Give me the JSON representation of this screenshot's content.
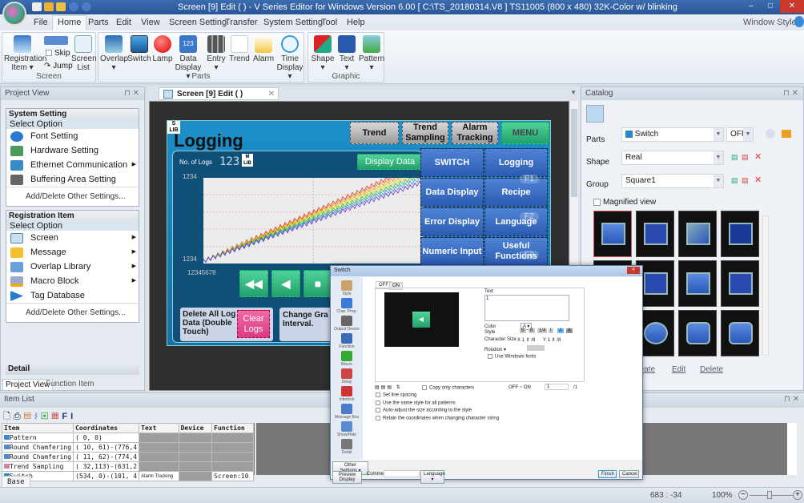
{
  "titlebar": {
    "title": "Screen [9] Edit (                    ) - V Series Editor for Windows Version 6.00 [ C:\\TS_20180314.V8 ] TS11005 (800 x 480) 32K-Color w/  blinking"
  },
  "menu": {
    "items": [
      "File",
      "Home",
      "Parts",
      "Edit",
      "View",
      "Screen Setting",
      "Transfer",
      "System Setting",
      "Tool",
      "Help"
    ],
    "active": "Home",
    "window_style": "Window Style"
  },
  "ribbon": {
    "screen_group": {
      "label": "Screen",
      "registration": "Registration Item",
      "skip": "Skip",
      "jump": "Jump",
      "screen_list": "Screen List"
    },
    "parts_group": {
      "label": "Parts",
      "items": [
        "Overlap",
        "Switch",
        "Lamp",
        "Data Display",
        "Entry",
        "Trend",
        "Alarm",
        "Time Display"
      ]
    },
    "graphic_group": {
      "label": "Graphic",
      "items": [
        "Shape",
        "Text",
        "Pattern"
      ]
    }
  },
  "project_view": {
    "title": "Project View",
    "system_setting": {
      "header": "System Setting",
      "select": "Select Option",
      "items": [
        "Font Setting",
        "Hardware Setting",
        "Ethernet Communication",
        "Buffering Area Setting"
      ],
      "add": "Add/Delete Other Settings..."
    },
    "registration_item": {
      "header": "Registration Item",
      "select": "Select Option",
      "items": [
        "Screen",
        "Message",
        "Overlap Library",
        "Macro Block",
        "Tag Database"
      ],
      "add": "Add/Delete Other Settings..."
    },
    "detail": "Detail",
    "tabs": [
      "Project View",
      "Function Item"
    ]
  },
  "editor": {
    "tab": "Screen [9] Edit (              )"
  },
  "hmi": {
    "title": "Logging",
    "top_buttons": [
      "Trend",
      "Trend Sampling",
      "Alarm Tracking",
      "MENU"
    ],
    "no_of_logs": "No. of Logs",
    "log_count": "123",
    "display_data": "Display Data",
    "y_top": "1234",
    "y_bottom": "1234",
    "x_label": "12345678",
    "menu_buttons": [
      "SWITCH",
      "Logging",
      "Data Display",
      "Recipe",
      "Error Display",
      "Language",
      "Numeric Input",
      "Useful Functions"
    ],
    "f_keys": [
      "F1",
      "F2",
      "F3"
    ],
    "delete_text": "Delete All Log Data (Double Touch)",
    "clear_logs": "Clear Logs",
    "change_text": "Change Gra Interval."
  },
  "catalog": {
    "title": "Catalog",
    "parts_label": "Parts",
    "parts_value": "Switch",
    "state_value": "OFF",
    "shape_label": "Shape",
    "shape_value": "Real",
    "group_label": "Group",
    "group_value": "Square1",
    "magnified": "Magnified view",
    "links": [
      "Create",
      "Edit",
      "Delete"
    ]
  },
  "item_list": {
    "title": "Item List",
    "columns": [
      "Item",
      "Coordinates",
      "Text",
      "Device",
      "Function"
    ],
    "rows": [
      {
        "item": "Pattern",
        "coords": "(  0,  0)",
        "text": "",
        "device": "",
        "function": ""
      },
      {
        "item": "Round Chamfering",
        "coords": "( 10, 61)-(776,4",
        "text": "",
        "device": "",
        "function": ""
      },
      {
        "item": "Round Chamfering",
        "coords": "( 11, 62)-(774,4",
        "text": "",
        "device": "",
        "function": ""
      },
      {
        "item": "Trend Sampling",
        "coords": "( 32,113)-(631,2",
        "text": "",
        "device": "",
        "function": ""
      },
      {
        "item": "Switch",
        "coords": "(534,  0)-(101, 4",
        "text": "Alarm Tracking",
        "device": "",
        "function": "Screen:10"
      }
    ],
    "tab": "Base"
  },
  "status": {
    "coords": "683 : -34",
    "zoom": "100%"
  },
  "dialog": {
    "title": "Switch",
    "side": [
      "Style",
      "Char. Prop.",
      "Output Device",
      "Function",
      "Macro",
      "Delay",
      "Interlock",
      "Message Box",
      "Show/Hide",
      "Detail"
    ],
    "tabs": [
      "OFF",
      "ON"
    ],
    "text_label": "Text",
    "text_value": "1",
    "color": "Color",
    "style": "Style",
    "char_size": "Character Size",
    "rotation": "Rotation",
    "size_x": "1",
    "size_y": "1",
    "size_div": "/8",
    "use_windows_fonts": "Use Windows fonts",
    "copy_only": "Copy only characters",
    "off_on": "OFF ~ ON",
    "off_on_value": "1",
    "off_on_max": "/1",
    "checks": [
      "Set line spacing",
      "Use the same style for all patterns",
      "Auto-adjust the size according to the style",
      "Retain the coordinates when changing character string"
    ],
    "other_settings": "Other Settings",
    "preview": "Preview Display",
    "comment": "Comme",
    "language": "Language",
    "finish": "Finish",
    "cancel": "Cancel"
  },
  "colors": {
    "titlebar": "#2a5597",
    "hmi_bg": "#1470a8",
    "menu_blue": "#2c5cb2",
    "green": "#23a06b",
    "pink": "#e8408a"
  }
}
